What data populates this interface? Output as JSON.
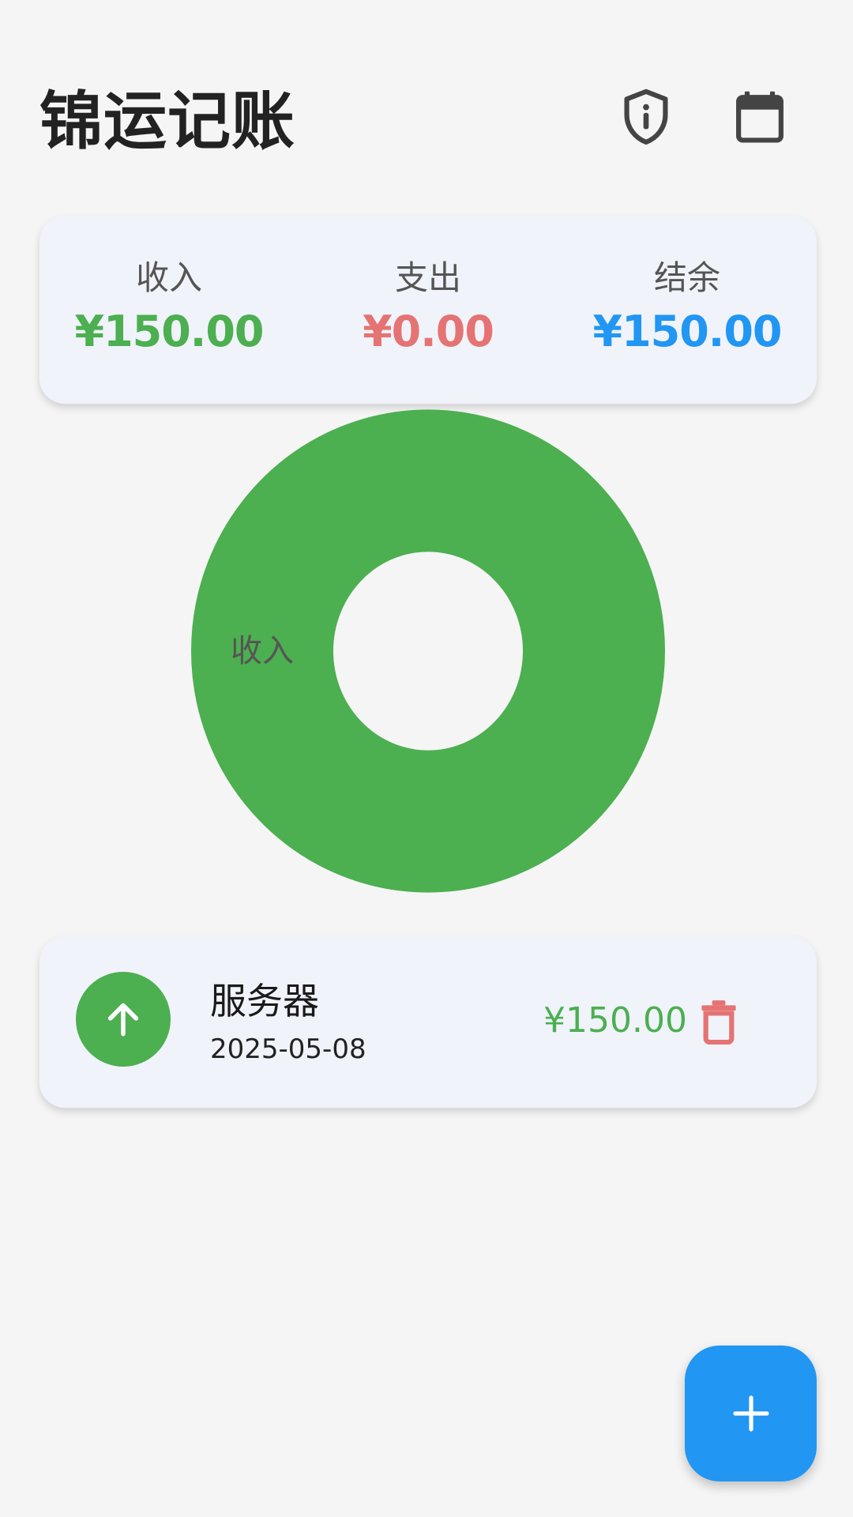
{
  "header": {
    "title": "锦运记账",
    "privacy_icon": "shield-info-icon",
    "calendar_icon": "calendar-icon"
  },
  "summary": {
    "income_label": "收入",
    "income_value": "¥150.00",
    "expense_label": "支出",
    "expense_value": "¥0.00",
    "balance_label": "结余",
    "balance_value": "¥150.00"
  },
  "chart_data": {
    "type": "pie",
    "style": "donut",
    "slices": [
      {
        "label": "收入",
        "value": 150.0,
        "color": "#4caf50"
      }
    ]
  },
  "records": [
    {
      "type": "income",
      "icon": "arrow-up-icon",
      "title": "服务器",
      "date": "2025-05-08",
      "amount": "¥150.00",
      "delete_icon": "trash-icon"
    }
  ],
  "fab": {
    "icon": "plus-icon"
  },
  "colors": {
    "income": "#4caf50",
    "expense": "#e57373",
    "balance": "#2196f3",
    "fab": "#2196f3",
    "card": "#f0f3fa",
    "background": "#f5f5f5"
  }
}
